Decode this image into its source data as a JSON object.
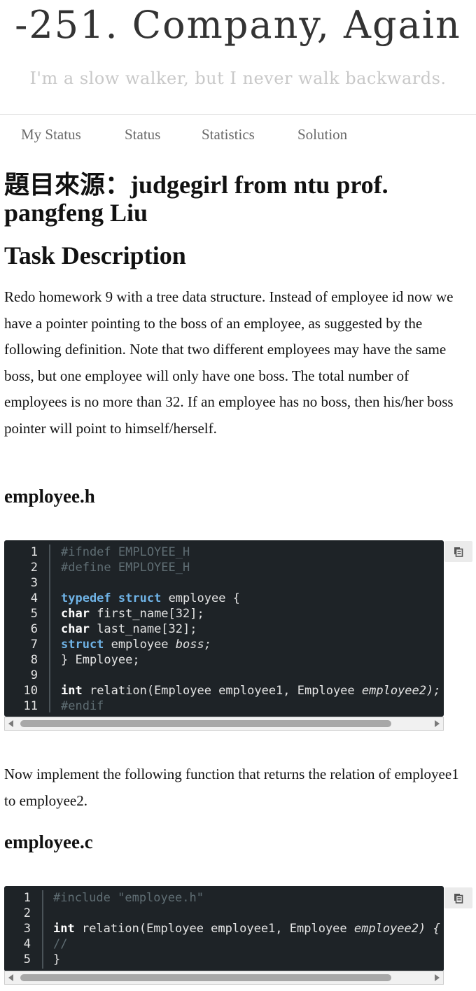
{
  "site": {
    "title": "-251. Company, Again",
    "subtitle": "I'm a slow walker, but I never walk backwards."
  },
  "nav": {
    "items": [
      {
        "label": "My Status"
      },
      {
        "label": "Status"
      },
      {
        "label": "Statistics"
      },
      {
        "label": "Solution"
      }
    ]
  },
  "content": {
    "source_heading": "題目來源：judgegirl from ntu prof. pangfeng Liu",
    "task_heading": "Task Description",
    "task_paragraph": "Redo homework 9 with a tree data structure. Instead of employee id now we have a pointer pointing to the boss of an employee, as suggested by the following definition. Note that two different employees may have the same boss, but one employee will only have one boss. The total number of employees is no more than 32. If an employee has no boss, then his/her boss pointer will point to himself/herself.",
    "header_file_heading": "employee.h",
    "implement_paragraph": "Now implement the following function that returns the relation of employee1 to employee2.",
    "source_file_heading": "employee.c"
  },
  "code_header": {
    "lines": [
      {
        "n": "1",
        "t": "#ifndef EMPLOYEE_H"
      },
      {
        "n": "2",
        "t": "#define EMPLOYEE_H"
      },
      {
        "n": "3",
        "t": ""
      },
      {
        "n": "4",
        "a": "typedef",
        "b": " ",
        "c": "struct",
        "d": " employee {"
      },
      {
        "n": "5",
        "a": "char",
        "d": " first_name[32];"
      },
      {
        "n": "6",
        "a": "char",
        "d": " last_name[32];"
      },
      {
        "n": "7",
        "a": "struct",
        "d": " employee ",
        "e": "boss;"
      },
      {
        "n": "8",
        "d": "} Employee;"
      },
      {
        "n": "9",
        "t": ""
      },
      {
        "n": "10",
        "a": "int",
        "d": " relation(Employee employee1, Employee ",
        "e": "employee2);"
      },
      {
        "n": "11",
        "t": "#endif"
      }
    ]
  },
  "code_source": {
    "lines": [
      {
        "n": "1",
        "t": "#include \"employee.h\""
      },
      {
        "n": "2",
        "t": ""
      },
      {
        "n": "3",
        "a": "int",
        "d": " relation(Employee employee1, Employee ",
        "e": "employee2) {"
      },
      {
        "n": "4",
        "t": "//"
      },
      {
        "n": "5",
        "d": "}"
      }
    ]
  },
  "icons": {
    "copy": "copy-icon",
    "scroll_left": "scroll-left-arrow-icon",
    "scroll_right": "scroll-right-arrow-icon"
  }
}
